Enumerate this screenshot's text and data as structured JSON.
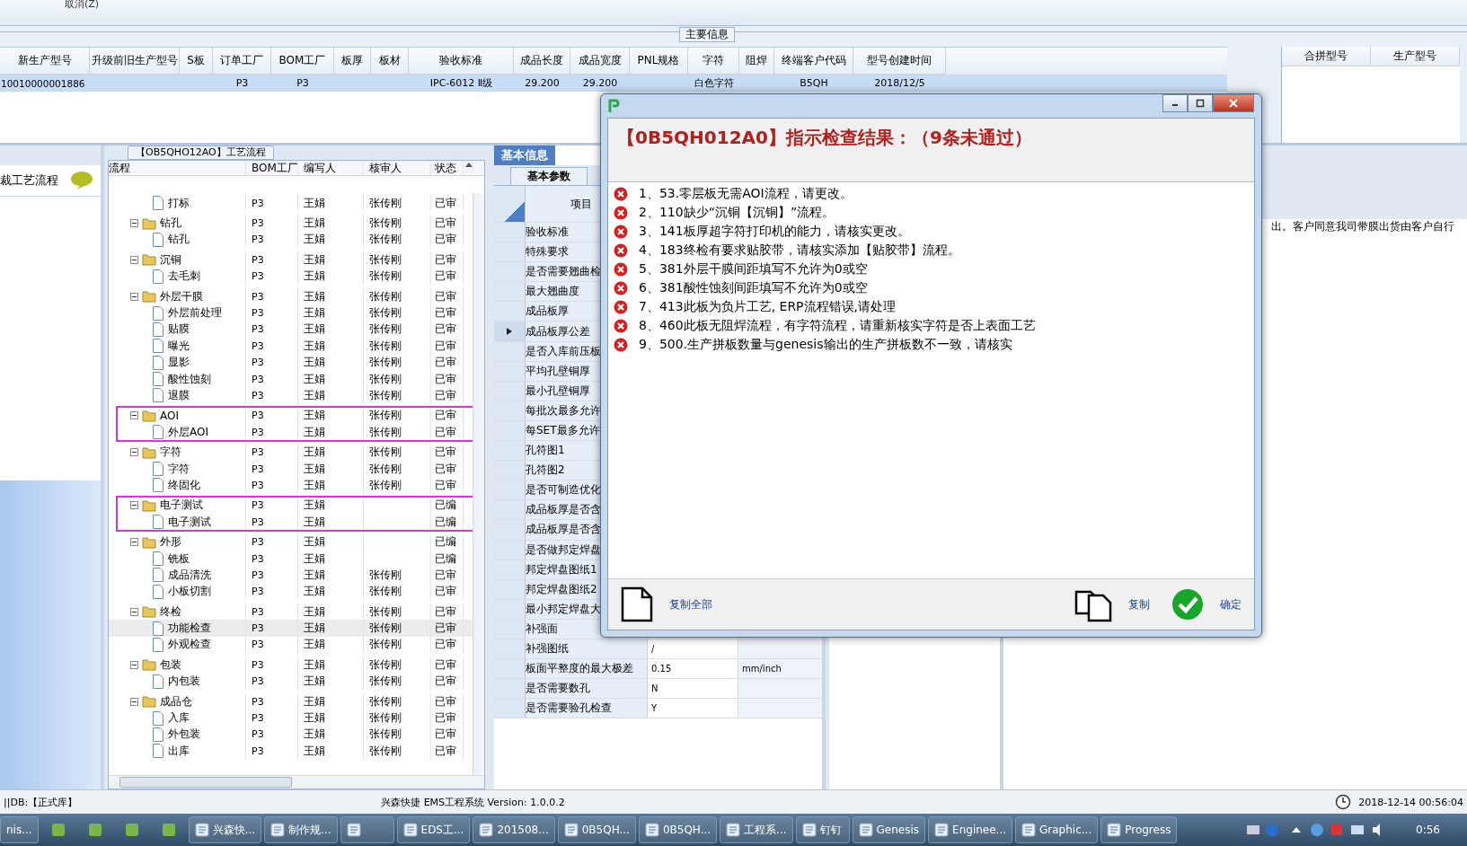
{
  "menu": {
    "label": "取消(Z)"
  },
  "main_info": {
    "title": "主要信息",
    "columns": [
      "新生产型号",
      "升级前旧生产型号",
      "S板",
      "订单工厂",
      "BOM工厂",
      "板厚",
      "板材",
      "验收标准",
      "成品长度",
      "成品宽度",
      "PNL规格",
      "字符",
      "阻焊",
      "终端客户代码",
      "型号创建时间"
    ],
    "rows": [
      {
        "selected": true,
        "cells": [
          "10010000001886",
          null,
          null,
          "P3",
          "P3",
          null,
          null,
          "IPC-6012 Ⅱ级",
          "29.200",
          "29.200",
          null,
          "白色字符",
          null,
          "B5QH",
          "2018/12/5"
        ]
      }
    ],
    "side_columns": [
      "合拼型号",
      "生产型号"
    ]
  },
  "sidebar": {
    "title": "裁工艺流程"
  },
  "flow": {
    "title": "【OB5QHO12AO】工艺流程",
    "columns": [
      "流程",
      "BOM工厂",
      "编写人",
      "核审人",
      "状态"
    ],
    "nodes": [
      {
        "kind": "leaf",
        "label": "打标",
        "bom": "P3",
        "writer": "王娟",
        "reviewer": "张传刚",
        "status": "已审",
        "selected": false
      },
      {
        "kind": "folder",
        "label": "钻孔",
        "bom": "P3",
        "writer": "王娟",
        "reviewer": "张传刚",
        "status": "已审",
        "expanded": true,
        "highlighted": false,
        "selected": false,
        "children": [
          {
            "kind": "leaf",
            "label": "钻孔",
            "bom": "P3",
            "writer": "王娟",
            "reviewer": "张传刚",
            "status": "已审",
            "selected": false
          }
        ]
      },
      {
        "kind": "folder",
        "label": "沉铜",
        "bom": "P3",
        "writer": "王娟",
        "reviewer": "张传刚",
        "status": "已审",
        "expanded": true,
        "highlighted": false,
        "selected": false,
        "children": [
          {
            "kind": "leaf",
            "label": "去毛刺",
            "bom": "P3",
            "writer": "王娟",
            "reviewer": "张传刚",
            "status": "已审",
            "selected": false
          }
        ]
      },
      {
        "kind": "folder",
        "label": "外层干膜",
        "bom": "P3",
        "writer": "王娟",
        "reviewer": "张传刚",
        "status": "已审",
        "expanded": true,
        "highlighted": false,
        "selected": false,
        "children": [
          {
            "kind": "leaf",
            "label": "外层前处理",
            "bom": "P3",
            "writer": "王娟",
            "reviewer": "张传刚",
            "status": "已审",
            "selected": false
          },
          {
            "kind": "leaf",
            "label": "贴膜",
            "bom": "P3",
            "writer": "王娟",
            "reviewer": "张传刚",
            "status": "已审",
            "selected": false
          },
          {
            "kind": "leaf",
            "label": "曝光",
            "bom": "P3",
            "writer": "王娟",
            "reviewer": "张传刚",
            "status": "已审",
            "selected": false
          },
          {
            "kind": "leaf",
            "label": "显影",
            "bom": "P3",
            "writer": "王娟",
            "reviewer": "张传刚",
            "status": "已审",
            "selected": false
          },
          {
            "kind": "leaf",
            "label": "酸性蚀刻",
            "bom": "P3",
            "writer": "王娟",
            "reviewer": "张传刚",
            "status": "已审",
            "selected": false
          },
          {
            "kind": "leaf",
            "label": "退膜",
            "bom": "P3",
            "writer": "王娟",
            "reviewer": "张传刚",
            "status": "已审",
            "selected": false
          }
        ]
      },
      {
        "kind": "folder",
        "label": "AOI",
        "bom": "P3",
        "writer": "王娟",
        "reviewer": "张传刚",
        "status": "已审",
        "expanded": true,
        "highlighted": true,
        "selected": false,
        "children": [
          {
            "kind": "leaf",
            "label": "外层AOI",
            "bom": "P3",
            "writer": "王娟",
            "reviewer": "张传刚",
            "status": "已审",
            "selected": false
          }
        ]
      },
      {
        "kind": "folder",
        "label": "字符",
        "bom": "P3",
        "writer": "王娟",
        "reviewer": "张传刚",
        "status": "已审",
        "expanded": true,
        "highlighted": false,
        "selected": false,
        "children": [
          {
            "kind": "leaf",
            "label": "字符",
            "bom": "P3",
            "writer": "王娟",
            "reviewer": "张传刚",
            "status": "已审",
            "selected": false
          },
          {
            "kind": "leaf",
            "label": "终固化",
            "bom": "P3",
            "writer": "王娟",
            "reviewer": "张传刚",
            "status": "已审",
            "selected": false
          }
        ]
      },
      {
        "kind": "folder",
        "label": "电子测试",
        "bom": "P3",
        "writer": "王娟",
        "status": "已编",
        "expanded": true,
        "highlighted": true,
        "selected": false,
        "children": [
          {
            "kind": "leaf",
            "label": "电子测试",
            "bom": "P3",
            "writer": "王娟",
            "status": "已编",
            "selected": false
          }
        ]
      },
      {
        "kind": "folder",
        "label": "外形",
        "bom": "P3",
        "writer": "王娟",
        "status": "已编",
        "expanded": true,
        "highlighted": false,
        "selected": false,
        "children": [
          {
            "kind": "leaf",
            "label": "铣板",
            "bom": "P3",
            "writer": "王娟",
            "status": "已编",
            "selected": false
          },
          {
            "kind": "leaf",
            "label": "成品清洗",
            "bom": "P3",
            "writer": "王娟",
            "reviewer": "张传刚",
            "status": "已审",
            "selected": false
          },
          {
            "kind": "leaf",
            "label": "小板切割",
            "bom": "P3",
            "writer": "王娟",
            "reviewer": "张传刚",
            "status": "已审",
            "selected": false
          }
        ]
      },
      {
        "kind": "folder",
        "label": "终检",
        "bom": "P3",
        "writer": "王娟",
        "reviewer": "张传刚",
        "status": "已审",
        "expanded": true,
        "highlighted": false,
        "selected": false,
        "children": [
          {
            "kind": "leaf",
            "label": "功能检查",
            "bom": "P3",
            "writer": "王娟",
            "reviewer": "张传刚",
            "status": "已审",
            "selected": true
          },
          {
            "kind": "leaf",
            "label": "外观检查",
            "bom": "P3",
            "writer": "王娟",
            "reviewer": "张传刚",
            "status": "已审",
            "selected": false
          }
        ]
      },
      {
        "kind": "folder",
        "label": "包装",
        "bom": "P3",
        "writer": "王娟",
        "reviewer": "张传刚",
        "status": "已审",
        "expanded": true,
        "highlighted": false,
        "selected": false,
        "children": [
          {
            "kind": "leaf",
            "label": "内包装",
            "bom": "P3",
            "writer": "王娟",
            "reviewer": "张传刚",
            "status": "已审",
            "selected": false
          }
        ]
      },
      {
        "kind": "folder",
        "label": "成品仓",
        "bom": "P3",
        "writer": "王娟",
        "reviewer": "张传刚",
        "status": "已审",
        "expanded": true,
        "highlighted": false,
        "selected": false,
        "children": [
          {
            "kind": "leaf",
            "label": "入库",
            "bom": "P3",
            "writer": "王娟",
            "reviewer": "张传刚",
            "status": "已审",
            "selected": false
          },
          {
            "kind": "leaf",
            "label": "外包装",
            "bom": "P3",
            "writer": "王娟",
            "reviewer": "张传刚",
            "status": "已审",
            "selected": false
          },
          {
            "kind": "leaf",
            "label": "出库",
            "bom": "P3",
            "writer": "王娟",
            "reviewer": "张传刚",
            "status": "已审",
            "selected": false
          }
        ]
      }
    ]
  },
  "basic_info": {
    "tab": "基本信息",
    "subtab": "基本参数",
    "item_header": "项目",
    "rows": [
      {
        "item": "验收标准",
        "current": false
      },
      {
        "item": "特殊要求",
        "current": false
      },
      {
        "item": "是否需要翘曲检",
        "current": false
      },
      {
        "item": "最大翘曲度",
        "current": false
      },
      {
        "item": "成品板厚",
        "current": false
      },
      {
        "item": "成品板厚公差",
        "current": true
      },
      {
        "item": "是否入库前压板",
        "current": false
      },
      {
        "item": "平均孔壁铜厚",
        "current": false
      },
      {
        "item": "最小孔壁铜厚",
        "current": false
      },
      {
        "item": "每批次最多允许",
        "current": false
      },
      {
        "item": "每SET最多允许",
        "current": false
      },
      {
        "item": "孔符图1",
        "current": false
      },
      {
        "item": "孔符图2",
        "current": false
      },
      {
        "item": "是否可制造优化",
        "current": false
      },
      {
        "item": "成品板厚是否含",
        "current": false
      },
      {
        "item": "成品板厚是否含",
        "current": false
      },
      {
        "item": "是否做邦定焊盘",
        "current": false
      },
      {
        "item": "邦定焊盘图纸1",
        "current": false
      },
      {
        "item": "邦定焊盘图纸2",
        "current": false
      },
      {
        "item": "最小邦定焊盘大",
        "current": false
      },
      {
        "item": "补强面",
        "current": false
      },
      {
        "item": "补强图纸",
        "value": "/",
        "current": false
      },
      {
        "item": "板面平整度的最大极差",
        "value": "0.15",
        "unit": "mm/inch",
        "current": false
      },
      {
        "item": "是否需要数孔",
        "value": "N",
        "current": false
      },
      {
        "item": "是否需要验孔检查",
        "value": "Y",
        "current": false
      }
    ]
  },
  "remarks": {
    "text": "出。客户同意我司带膜出货由客户自行"
  },
  "dialog": {
    "title": "【0B5QH012A0】指示检查结果：（9条未通过）",
    "results": [
      {
        "text": "1、53.零层板无需AOI流程，请更改。",
        "passed": false
      },
      {
        "text": "2、110缺少“沉铜【沉铜】”流程。",
        "passed": false
      },
      {
        "text": "3、141板厚超字符打印机的能力，请核实更改。",
        "passed": false
      },
      {
        "text": "4、183终检有要求贴胶带，请核实添加【贴胶带】流程。",
        "passed": false
      },
      {
        "text": "5、381外层干膜间距填写不允许为0或空",
        "passed": false
      },
      {
        "text": "6、381酸性蚀刻间距填写不允许为0或空",
        "passed": false
      },
      {
        "text": "7、413此板为负片工艺, ERP流程错误,请处理",
        "passed": false
      },
      {
        "text": "8、460此板无阻焊流程，有字符流程，请重新核实字符是否上表面工艺",
        "passed": false
      },
      {
        "text": "9、500.生产拼板数量与genesis输出的生产拼板数不一致，请核实",
        "passed": false
      }
    ],
    "buttons": [
      {
        "kind": "copy_all",
        "label": "复制全部"
      },
      {
        "kind": "copy",
        "label": "复制"
      },
      {
        "kind": "ok",
        "label": "确定"
      }
    ]
  },
  "status_bar": {
    "db": "||DB:【正式库】",
    "app": "兴森快捷 EMS工程系统 Version: 1.0.0.2",
    "datetime": "2018-12-14 00:56:04"
  },
  "taskbar": {
    "items": [
      {
        "kind": "text",
        "label": "nis..."
      },
      {
        "kind": "icon"
      },
      {
        "kind": "icon"
      },
      {
        "kind": "icon"
      },
      {
        "kind": "icon"
      },
      {
        "kind": "button",
        "label": "兴森快..."
      },
      {
        "kind": "button",
        "label": "制作规..."
      },
      {
        "kind": "button"
      },
      {
        "kind": "button",
        "label": "EDS工..."
      },
      {
        "kind": "button",
        "label": "201508..."
      },
      {
        "kind": "button",
        "label": "0B5QH..."
      },
      {
        "kind": "button",
        "label": "0B5QH..."
      },
      {
        "kind": "button",
        "label": "工程系..."
      },
      {
        "kind": "button",
        "label": "钉钉"
      },
      {
        "kind": "button",
        "label": "Genesis"
      },
      {
        "kind": "button",
        "label": "Enginee..."
      },
      {
        "kind": "button",
        "label": "Graphic..."
      },
      {
        "kind": "button",
        "label": "Progress"
      }
    ],
    "clock": "0:56"
  }
}
